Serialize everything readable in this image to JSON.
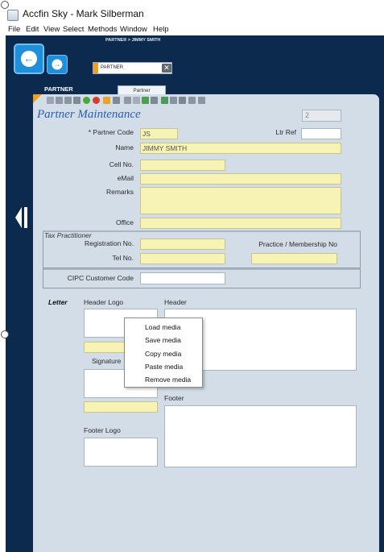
{
  "window": {
    "title": "Accfin Sky  - Mark Silberman"
  },
  "menu": [
    "File",
    "Edit",
    "View",
    "Select",
    "Methods",
    "Window",
    "Help"
  ],
  "nav": {
    "breadcrumb": "PARTNER > JIMMY SMITH",
    "crumb_label": "PARTNER",
    "section_label": "PARTNER",
    "tab_label": "Partner"
  },
  "form": {
    "title": "Partner Maintenance",
    "record_number": "2",
    "partner_code_label": "* Partner Code",
    "partner_code": "JS",
    "ltr_ref_label": "Ltr Ref",
    "ltr_ref": "",
    "name_label": "Name",
    "name": "JIMMY SMITH",
    "cell_label": "Cell No.",
    "cell": "",
    "email_label": "eMail",
    "email": "",
    "remarks_label": "Remarks",
    "remarks": "",
    "office_label": "Office",
    "office": "",
    "tax": {
      "title": "Tax Practitioner",
      "reg_label": "Registration No.",
      "tel_label": "Tel No.",
      "practice_label": "Practice / Membership No"
    },
    "cipc_label": "CIPC Customer Code",
    "letter": {
      "label": "Letter",
      "header_logo_label": "Header Logo",
      "header_label": "Header",
      "signature_label": "Signature",
      "footer_label": "Footer",
      "footer_logo_label": "Footer Logo"
    }
  },
  "context_menu": [
    "Load media",
    "Save media",
    "Copy media",
    "Paste media",
    "Remove media"
  ],
  "colors": {
    "accent": "#1e8fd8",
    "heading": "#2a5eb0",
    "field_yellow": "#f7f3b4",
    "panel": "#d2dde7",
    "app_bg": "#0c2a4e",
    "orange": "#f0a020"
  }
}
